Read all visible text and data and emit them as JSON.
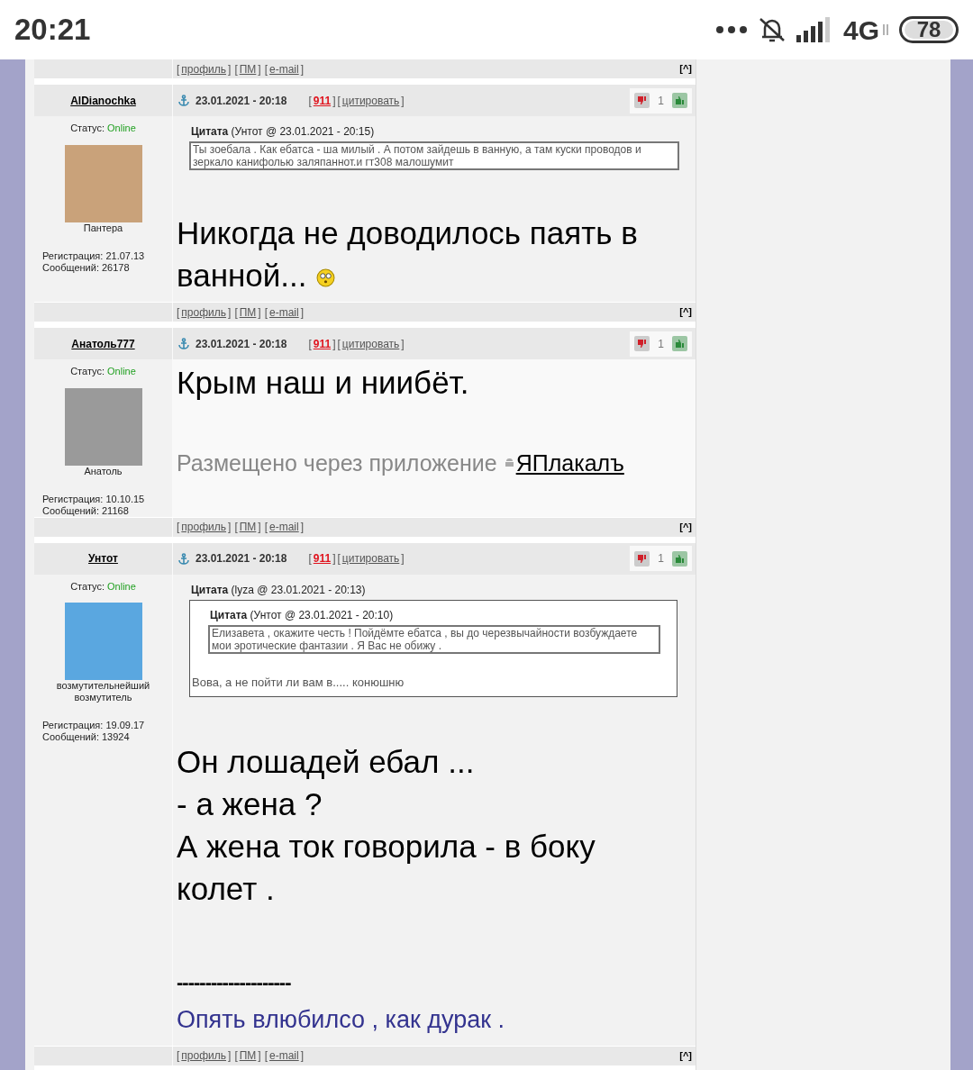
{
  "status_bar": {
    "time": "20:21",
    "network": "4G",
    "battery": "78"
  },
  "top_footer": {
    "links": [
      {
        "open": "[",
        "label": "профиль",
        "close": "]"
      },
      {
        "open": "[",
        "label": "ПМ",
        "close": "]"
      },
      {
        "open": "[",
        "label": "e-mail",
        "close": "]"
      }
    ],
    "top_link": "[^]"
  },
  "posts": [
    {
      "author": "AlDianochka",
      "status_label": "Статус:",
      "status": "Online",
      "avatar_caption": "Пантера",
      "registration": "Регистрация: 21.07.13",
      "messages": "Сообщений: 26178",
      "date": "23.01.2021 - 20:18",
      "number": {
        "open": "[",
        "label": "911",
        "close": "]"
      },
      "quote_button": {
        "open": "[",
        "label": "цитировать",
        "close": "]"
      },
      "rating": "1",
      "quote": {
        "title": "Цитата",
        "meta": "(Унтот @ 23.01.2021 - 20:15)",
        "text": "Ты зоебала . Как ебатса - ша милый . А потом зайдешь в ванную, а там куски проводов и зеркало канифолью заляпаннот.и гт308 малошумит"
      },
      "body": [
        {
          "kind": "text",
          "text": "Никогда не доводилось паять в ванной...",
          "smiley": true
        }
      ],
      "footer": {
        "links": [
          {
            "open": "[",
            "label": "профиль",
            "close": "]"
          },
          {
            "open": "[",
            "label": "ПМ",
            "close": "]"
          },
          {
            "open": "[",
            "label": "e-mail",
            "close": "]"
          }
        ],
        "top_link": "[^]"
      }
    },
    {
      "author": "Анатоль777",
      "status_label": "Статус:",
      "status": "Online",
      "avatar_caption": "Анатоль",
      "registration": "Регистрация: 10.10.15",
      "messages": "Сообщений: 21168",
      "date": "23.01.2021 - 20:18",
      "number": {
        "open": "[",
        "label": "911",
        "close": "]"
      },
      "quote_button": {
        "open": "[",
        "label": "цитировать",
        "close": "]"
      },
      "rating": "1",
      "body": [
        {
          "kind": "text",
          "text": "Крым наш и ниибёт.",
          "smiley": false
        },
        {
          "kind": "app_note",
          "text": "Размещено через приложение",
          "link": "ЯПлакалъ"
        }
      ],
      "footer": {
        "links": [
          {
            "open": "[",
            "label": "профиль",
            "close": "]"
          },
          {
            "open": "[",
            "label": "ПМ",
            "close": "]"
          },
          {
            "open": "[",
            "label": "e-mail",
            "close": "]"
          }
        ],
        "top_link": "[^]"
      }
    },
    {
      "author": "Унтот",
      "status_label": "Статус:",
      "status": "Online",
      "avatar_caption": "возмутительнейший возмутитель",
      "registration": "Регистрация: 19.09.17",
      "messages": "Сообщений: 13924",
      "date": "23.01.2021 - 20:18",
      "number": {
        "open": "[",
        "label": "911",
        "close": "]"
      },
      "quote_button": {
        "open": "[",
        "label": "цитировать",
        "close": "]"
      },
      "rating": "1",
      "quote": {
        "title": "Цитата",
        "meta": "(lyza @ 23.01.2021 - 20:13)",
        "inner": {
          "title": "Цитата",
          "meta": "(Унтот @ 23.01.2021 - 20:10)",
          "text": "Елизавета , окажите честь ! Пойдёмте ебатса , вы до черезвычайности возбуждаете мои эротические фантазии . Я Вас не обижу ."
        },
        "text": "Вова, а не пойти ли вам в..... конюшню"
      },
      "body": [
        {
          "kind": "text",
          "text": "Он лошадей ебал ...",
          "smiley": false
        },
        {
          "kind": "text",
          "text": "- а жена ?",
          "smiley": false
        },
        {
          "kind": "text",
          "text": "А жена ток говорила - в боку колет .",
          "smiley": false
        },
        {
          "kind": "divider_text",
          "text": "--------------------"
        },
        {
          "kind": "signature",
          "text": "Опять влюбилсо , как дурак ."
        }
      ],
      "footer": {
        "links": [
          {
            "open": "[",
            "label": "профиль",
            "close": "]"
          },
          {
            "open": "[",
            "label": "ПМ",
            "close": "]"
          },
          {
            "open": "[",
            "label": "e-mail",
            "close": "]"
          }
        ],
        "top_link": "[^]"
      }
    }
  ]
}
